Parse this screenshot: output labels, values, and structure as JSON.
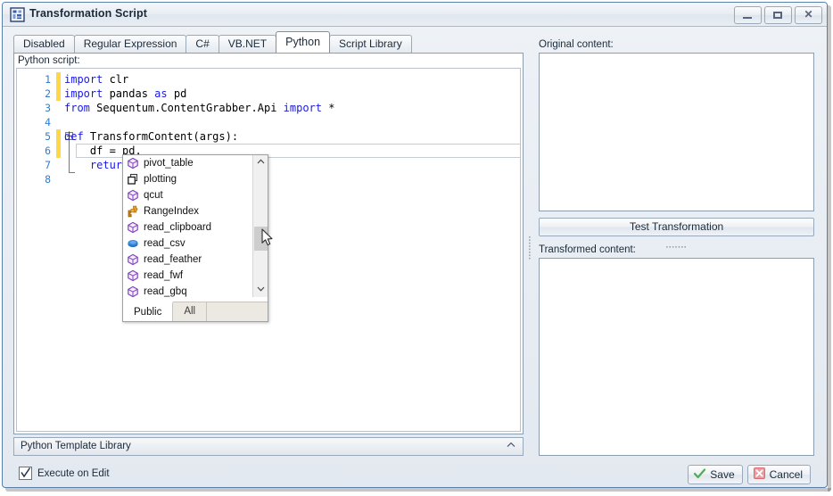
{
  "window": {
    "title": "Transformation Script",
    "icon": "script-window-icon",
    "controls": {
      "minimize": "Minimize",
      "maximize": "Maximize",
      "close": "Close"
    }
  },
  "tabs": [
    {
      "label": "Disabled",
      "active": false
    },
    {
      "label": "Regular Expression",
      "active": false
    },
    {
      "label": "C#",
      "active": false
    },
    {
      "label": "VB.NET",
      "active": false
    },
    {
      "label": "Python",
      "active": true
    },
    {
      "label": "Script Library",
      "active": false
    }
  ],
  "editor": {
    "label": "Python script:",
    "lines": [
      {
        "number": "1",
        "changed": true,
        "segments": [
          {
            "text": "import ",
            "kind": "keyword"
          },
          {
            "text": "clr",
            "kind": "plain"
          }
        ]
      },
      {
        "number": "2",
        "changed": true,
        "segments": [
          {
            "text": "import ",
            "kind": "keyword"
          },
          {
            "text": "pandas ",
            "kind": "plain"
          },
          {
            "text": "as ",
            "kind": "keyword"
          },
          {
            "text": "pd",
            "kind": "plain"
          }
        ]
      },
      {
        "number": "3",
        "changed": false,
        "segments": [
          {
            "text": "from ",
            "kind": "keyword"
          },
          {
            "text": "Sequentum.ContentGrabber.Api ",
            "kind": "plain"
          },
          {
            "text": "import ",
            "kind": "keyword"
          },
          {
            "text": "*",
            "kind": "plain"
          }
        ]
      },
      {
        "number": "4",
        "changed": false,
        "segments": []
      },
      {
        "number": "5",
        "changed": true,
        "segments": [
          {
            "text": "def ",
            "kind": "keyword"
          },
          {
            "text": "TransformContent(args):",
            "kind": "plain"
          }
        ]
      },
      {
        "number": "6",
        "changed": true,
        "segments": [
          {
            "text": "    df = pd.",
            "kind": "plain"
          }
        ]
      },
      {
        "number": "7",
        "changed": false,
        "segments": [
          {
            "text": "    ",
            "kind": "plain"
          },
          {
            "text": "return",
            "kind": "keyword"
          }
        ]
      },
      {
        "number": "8",
        "changed": false,
        "segments": []
      }
    ]
  },
  "autocomplete": {
    "items": [
      {
        "label": "pivot_table",
        "icon": "method-icon"
      },
      {
        "label": "plotting",
        "icon": "namespace-icon"
      },
      {
        "label": "qcut",
        "icon": "method-icon"
      },
      {
        "label": "RangeIndex",
        "icon": "class-icon"
      },
      {
        "label": "read_clipboard",
        "icon": "method-icon"
      },
      {
        "label": "read_csv",
        "icon": "extension-method-icon"
      },
      {
        "label": "read_feather",
        "icon": "method-icon"
      },
      {
        "label": "read_fwf",
        "icon": "method-icon"
      },
      {
        "label": "read_gbq",
        "icon": "method-icon"
      }
    ],
    "filter_tabs": [
      {
        "label": "Public",
        "selected": true
      },
      {
        "label": "All",
        "selected": false
      }
    ],
    "scroll_up_icon": "chevron-up-icon",
    "scroll_down_icon": "chevron-down-icon"
  },
  "template_library": {
    "label": "Python Template Library",
    "collapse_icon": "chevron-up-icon"
  },
  "footer": {
    "execute_on_edit": {
      "label": "Execute on Edit",
      "checked": true
    },
    "save_label": "Save",
    "save_icon": "check-icon",
    "cancel_label": "Cancel",
    "cancel_icon": "close-x-icon"
  },
  "right_panel": {
    "original_label": "Original content:",
    "original_value": "",
    "test_button_label": "Test Transformation",
    "transformed_label": "Transformed content:",
    "transformed_value": ""
  },
  "colors": {
    "keyword": "#1a1ae6",
    "line_number": "#2b7fd4",
    "change_marker": "#ffd945",
    "accent_border": "#5b7fa6",
    "save_icon": "#4caf50",
    "cancel_icon": "#ef7f85"
  }
}
